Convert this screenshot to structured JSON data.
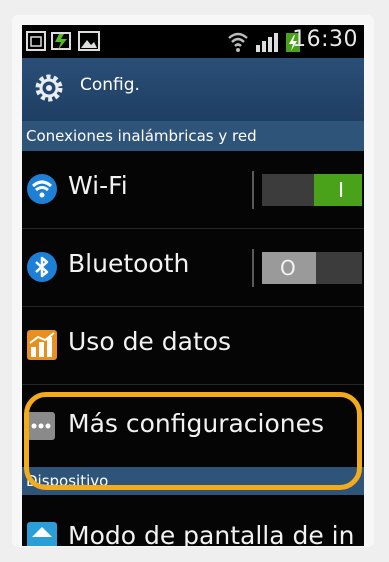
{
  "status_bar": {
    "time": "16:30",
    "icons": [
      "sim-icon",
      "battery-charging-icon",
      "gallery-icon",
      "wifi-signal-icon",
      "cell-signal-icon",
      "charging-bolt-icon"
    ]
  },
  "action_bar": {
    "title": "Config.",
    "icon": "gear-icon"
  },
  "sections": [
    {
      "header": "Conexiones inalámbricas y red",
      "items": [
        {
          "label": "Wi-Fi",
          "icon": "wifi-icon",
          "toggle": "on",
          "toggle_label": "I"
        },
        {
          "label": "Bluetooth",
          "icon": "bluetooth-icon",
          "toggle": "off",
          "toggle_label": "O"
        },
        {
          "label": "Uso de datos",
          "icon": "data-usage-icon"
        },
        {
          "label": "Más configuraciones",
          "icon": "more-settings-icon"
        }
      ]
    },
    {
      "header": "Dispositivo",
      "items": [
        {
          "label": "Modo de pantalla de in",
          "icon": "home-screen-icon"
        }
      ]
    }
  ],
  "colors": {
    "accent_toggle_on": "#4aa11a",
    "action_bar": "#234566",
    "section_header": "#2f5479",
    "highlight": "#f2ab1b"
  }
}
